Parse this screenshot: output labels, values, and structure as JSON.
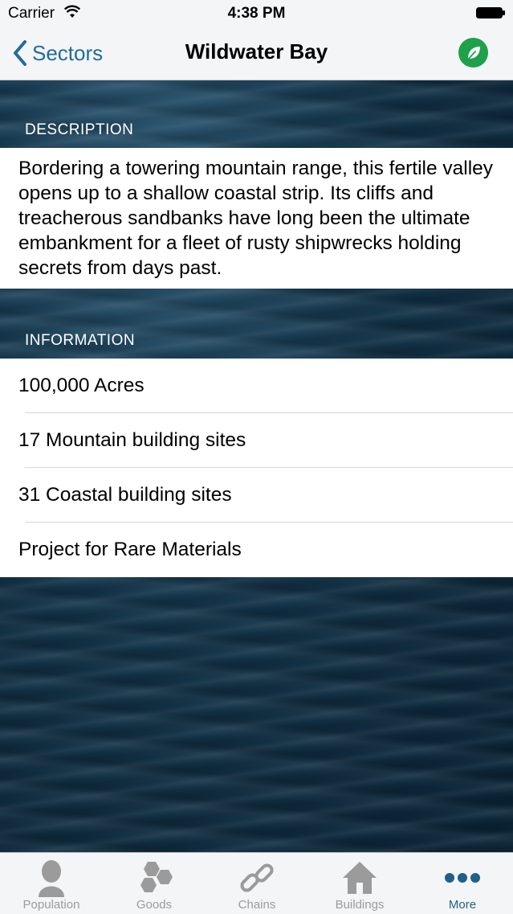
{
  "status_bar": {
    "carrier": "Carrier",
    "time": "4:38 PM"
  },
  "nav": {
    "back_label": "Sectors",
    "title": "Wildwater Bay",
    "action_icon": "leaf-icon",
    "accent_color": "#236b9a",
    "action_color": "#1fa04b"
  },
  "description": {
    "header": "DESCRIPTION",
    "text": "Bordering a towering mountain range, this fertile valley opens up to a shallow coastal strip. Its cliffs and treacherous sandbanks have long been the ultimate embankment for a fleet of rusty shipwrecks holding secrets from days past."
  },
  "information": {
    "header": "INFORMATION",
    "rows": [
      "100,000 Acres",
      "17 Mountain building sites",
      "31 Coastal building sites",
      "Project for Rare Materials"
    ]
  },
  "tab_bar": {
    "tabs": [
      {
        "label": "Population",
        "icon": "person-icon"
      },
      {
        "label": "Goods",
        "icon": "hexagons-icon"
      },
      {
        "label": "Chains",
        "icon": "chain-icon"
      },
      {
        "label": "Buildings",
        "icon": "house-icon"
      },
      {
        "label": "More",
        "icon": "more-icon"
      }
    ],
    "active": "More",
    "active_color": "#1f5f8b"
  }
}
